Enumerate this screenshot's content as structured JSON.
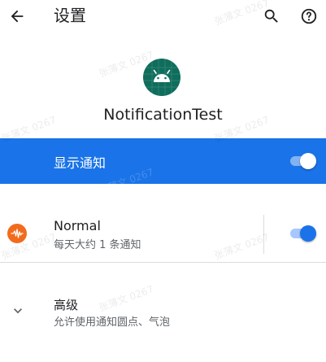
{
  "header": {
    "title": "设置",
    "back_icon": "arrow-back-icon",
    "search_icon": "search-icon",
    "help_icon": "help-circle-icon"
  },
  "app": {
    "icon": "android-icon",
    "name": "NotificationTest"
  },
  "show_notifications": {
    "label": "显示通知",
    "enabled": true
  },
  "channel": {
    "icon": "waveform-icon",
    "title": "Normal",
    "subtitle": "每天大约 1 条通知",
    "enabled": true
  },
  "advanced": {
    "icon": "chevron-down-icon",
    "title": "高级",
    "subtitle": "允许使用通知圆点、气泡"
  },
  "watermark": "张薄文 0267",
  "colors": {
    "accent": "#1a73e8",
    "app_icon_bg": "#0f6d5c",
    "channel_icon_bg": "#f26b1d"
  }
}
